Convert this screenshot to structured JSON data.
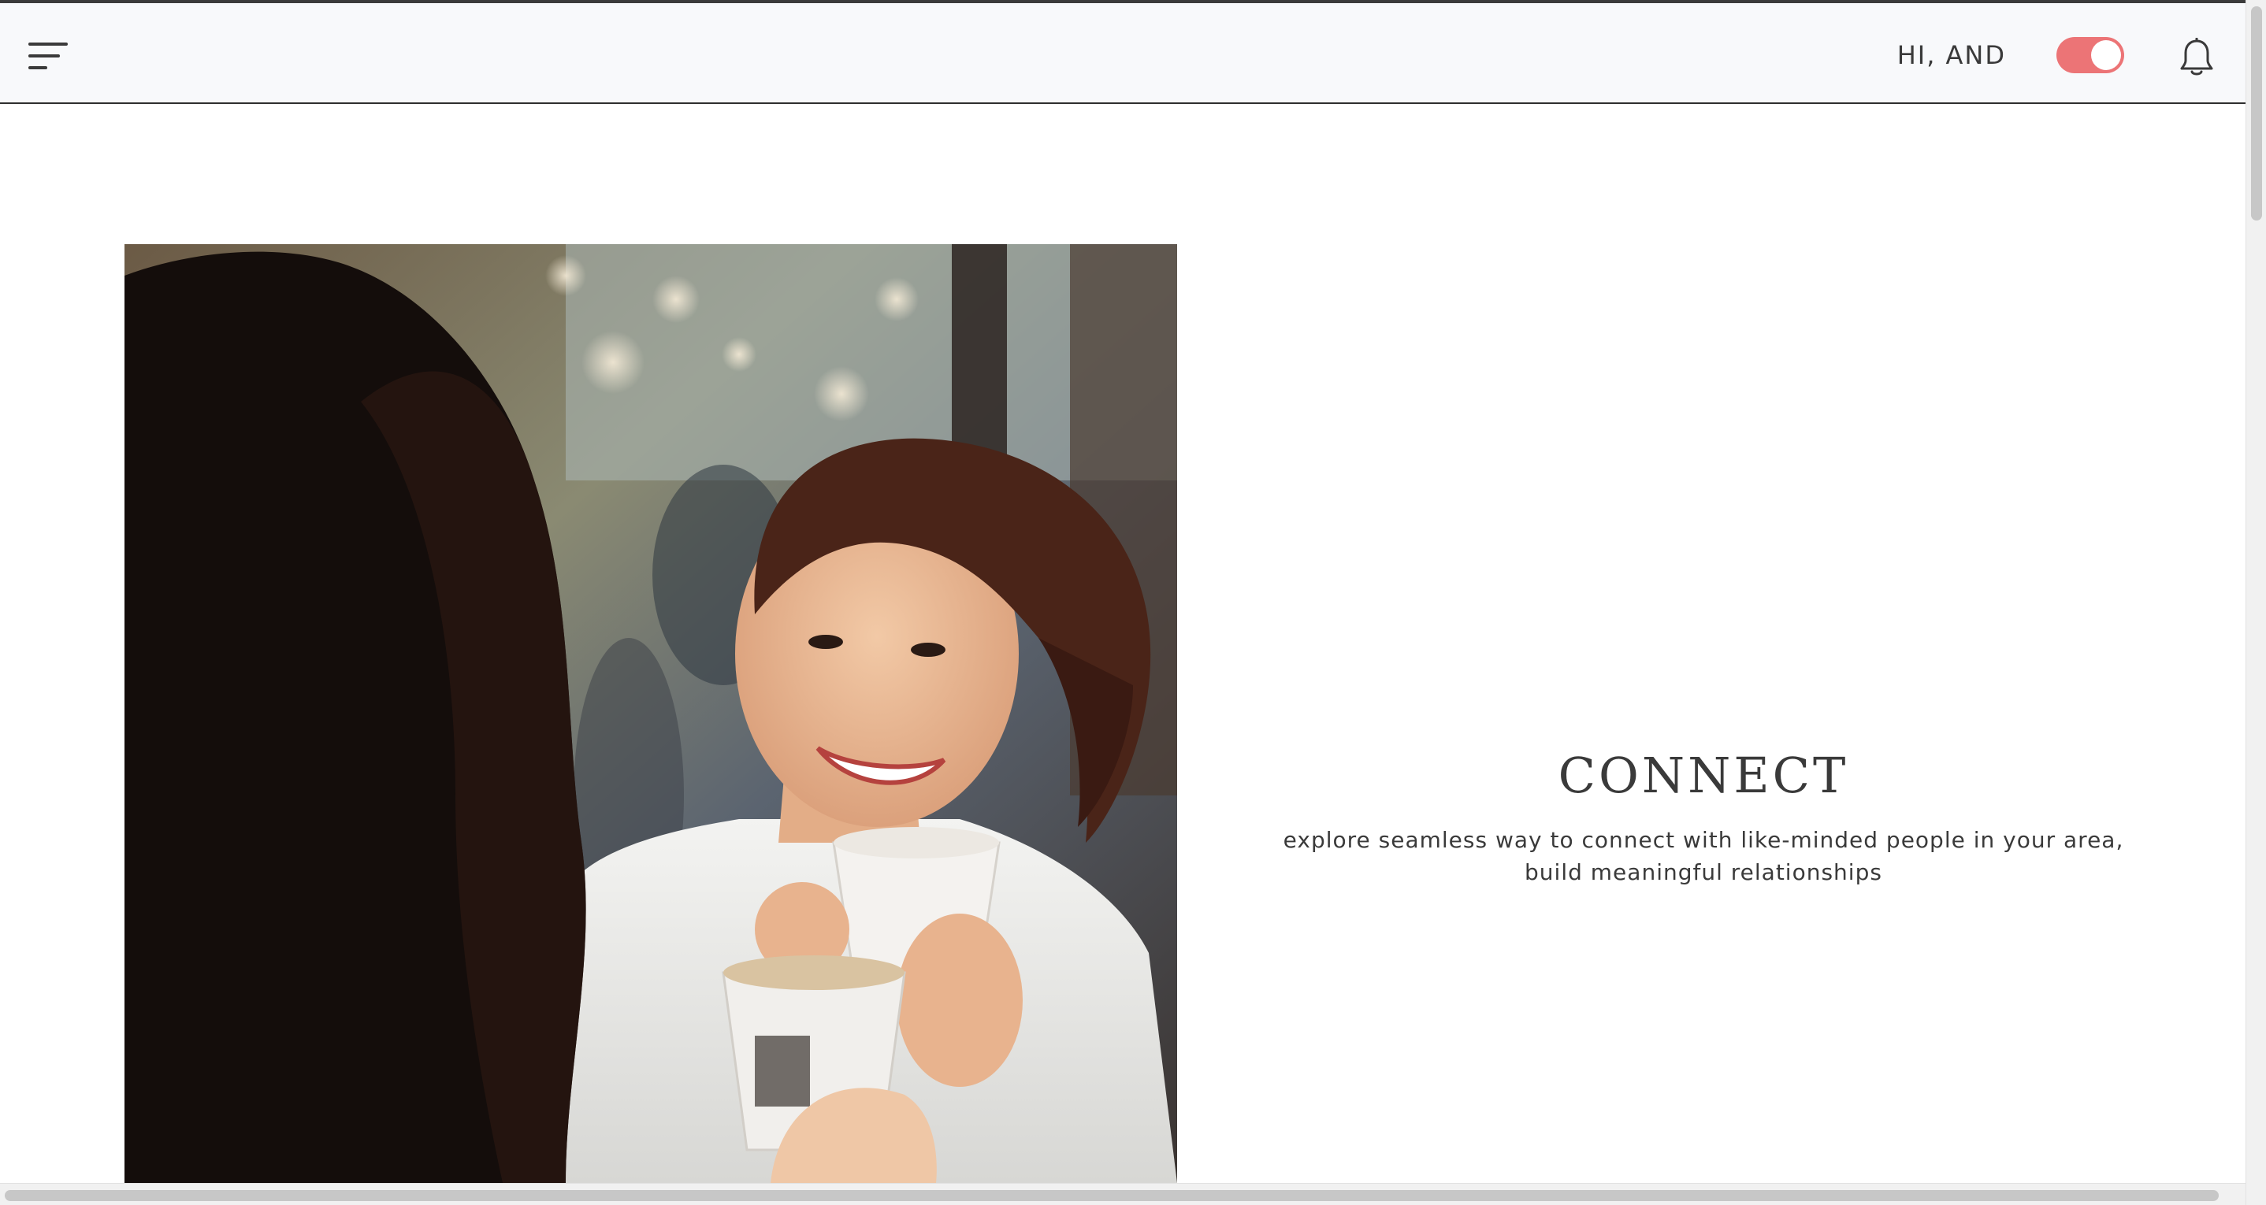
{
  "header": {
    "greeting": "HI, AND",
    "menu_icon": "hamburger-menu-icon",
    "toggle_state": "on",
    "toggle_color": "#ec7476",
    "bell_icon": "bell-icon"
  },
  "hero": {
    "image": "photo of two women sharing coffee",
    "title": "CONNECT",
    "description": "explore seamless way to connect with like-minded people in your area, build meaningful relationships"
  }
}
